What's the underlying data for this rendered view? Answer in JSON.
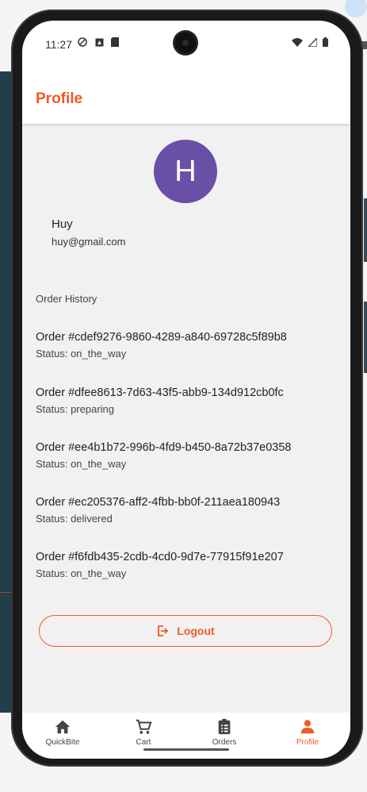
{
  "status_bar": {
    "time": "11:27"
  },
  "app_bar": {
    "title": "Profile"
  },
  "profile": {
    "avatar_letter": "H",
    "name": "Huy",
    "email": "huy@gmail.com"
  },
  "order_history": {
    "title": "Order History",
    "orders": [
      {
        "id": "Order #cdef9276-9860-4289-a840-69728c5f89b8",
        "status": "Status: on_the_way"
      },
      {
        "id": "Order #dfee8613-7d63-43f5-abb9-134d912cb0fc",
        "status": "Status: preparing"
      },
      {
        "id": "Order #ee4b1b72-996b-4fd9-b450-8a72b37e0358",
        "status": "Status: on_the_way"
      },
      {
        "id": "Order #ec205376-aff2-4fbb-bb0f-211aea180943",
        "status": "Status: delivered"
      },
      {
        "id": "Order #f6fdb435-2cdb-4cd0-9d7e-77915f91e207",
        "status": "Status: on_the_way"
      }
    ]
  },
  "logout_label": "Logout",
  "bottom_nav": [
    {
      "label": "QuickBite",
      "icon": "home-icon"
    },
    {
      "label": "Cart",
      "icon": "cart-icon"
    },
    {
      "label": "Orders",
      "icon": "clipboard-icon"
    },
    {
      "label": "Profile",
      "icon": "person-icon",
      "active": true
    }
  ],
  "colors": {
    "accent": "#f15a24",
    "avatar": "#6a4fa6",
    "background": "#f1f1f1"
  }
}
